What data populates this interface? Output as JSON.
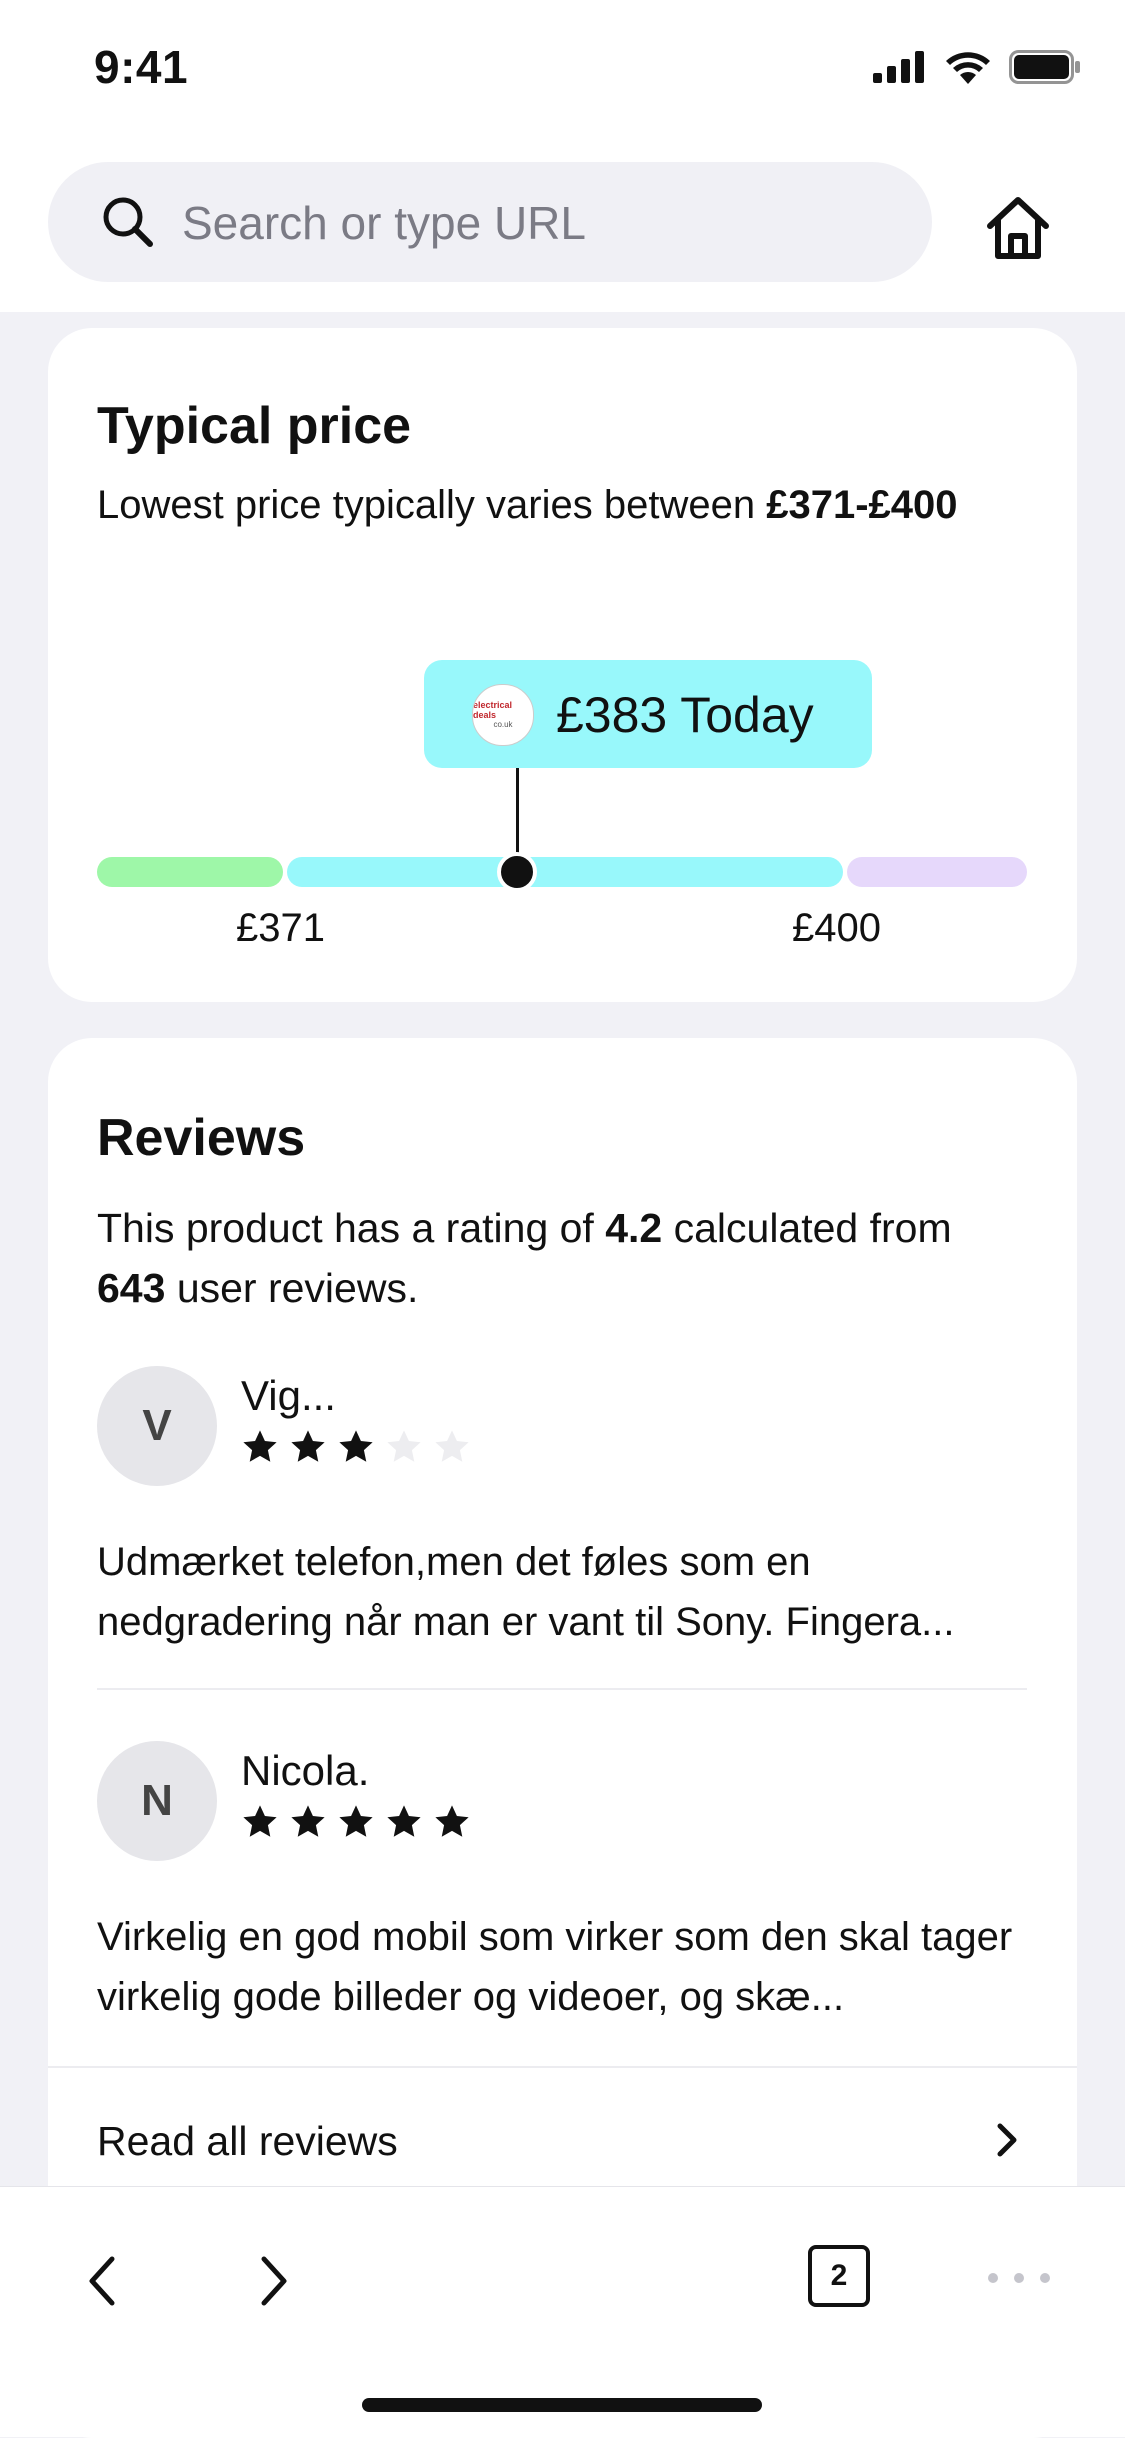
{
  "status_bar": {
    "time": "9:41"
  },
  "browser": {
    "search_placeholder": "Search or type URL",
    "tab_count": "2"
  },
  "price": {
    "title": "Typical price",
    "desc_prefix": "Lowest price typically varies between ",
    "desc_range": "£371-£400",
    "today_price": "£383 Today",
    "merchant_logo_text": "electrical deals",
    "merchant_logo_sub": "co.uk",
    "low_label": "£371",
    "high_label": "£400",
    "range": {
      "min": 371,
      "max": 400,
      "current": 383
    },
    "colors": {
      "low": "#9ef7a8",
      "typical": "#98f8fb",
      "high": "#e6d8fb"
    }
  },
  "reviews": {
    "title": "Reviews",
    "summary_prefix": "This product has a rating of ",
    "rating": "4.2",
    "summary_middle": " calculated from ",
    "count": "643",
    "summary_suffix": " user reviews.",
    "items": [
      {
        "initial": "V",
        "name": "Vig...",
        "stars": 3,
        "text": "Udmærket telefon,men det føles som en nedgradering når man er vant til Sony. Fingera..."
      },
      {
        "initial": "N",
        "name": "Nicola.",
        "stars": 5,
        "text": "Virkelig en god mobil som virker som den skal tager virkelig gode billeder og videoer, og skæ..."
      }
    ],
    "read_all": "Read all reviews"
  }
}
